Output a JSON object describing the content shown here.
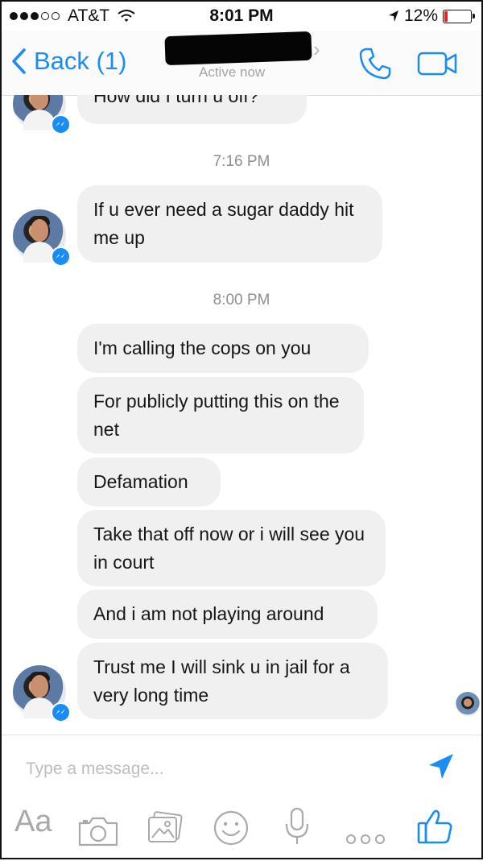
{
  "status_bar": {
    "carrier": "AT&T",
    "time": "8:01 PM",
    "battery_percent": "12%",
    "battery_level": 0.12
  },
  "nav": {
    "back_label": "Back (1)",
    "active_status": "Active now"
  },
  "conversation": {
    "top_message": "How did I turn u off?",
    "timestamp_1": "7:16 PM",
    "message_1": "If u ever need a sugar daddy hit me up",
    "timestamp_2": "8:00 PM",
    "messages": [
      "I'm calling the cops on you",
      "For publicly putting this on the net",
      "Defamation",
      "Take that off now or i will see you in court",
      "And i am not playing around",
      "Trust me I will sink u in jail for a very long time"
    ]
  },
  "composer": {
    "placeholder": "Type a message...",
    "aa_label": "Aa"
  },
  "colors": {
    "accent": "#1a8cf5",
    "bubble": "#f0f0f0",
    "battery_low": "#e5221f"
  },
  "icons": [
    "back-chevron-icon",
    "phone-icon",
    "video-camera-icon",
    "messenger-badge-icon",
    "send-icon",
    "camera-icon",
    "gallery-icon",
    "emoji-icon",
    "microphone-icon",
    "more-icon",
    "thumbs-up-icon"
  ]
}
